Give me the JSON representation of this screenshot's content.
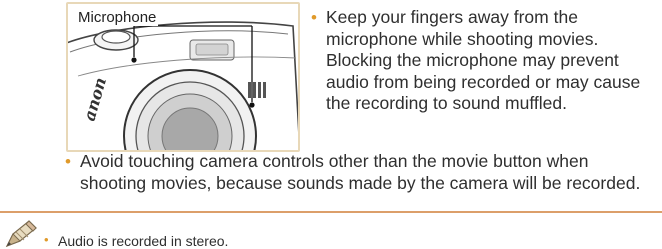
{
  "figure": {
    "callout_label": "Microphone",
    "brand_partial": "anon",
    "icon": "camera-microphone-illustration"
  },
  "bullets": [
    {
      "text": "Keep your fingers away from the microphone while shooting movies. Blocking the microphone may prevent audio from being recorded or may cause the recording to sound muffled."
    },
    {
      "text": "Avoid touching camera controls other than the movie button when shooting movies, because sounds made by the camera will be recorded."
    }
  ],
  "note": {
    "icon": "pencil-icon",
    "text": "Audio is recorded in stereo."
  },
  "colors": {
    "bullet": "#e09a2a",
    "divider": "#dc9f6a",
    "frame": "#e8d8b8"
  }
}
